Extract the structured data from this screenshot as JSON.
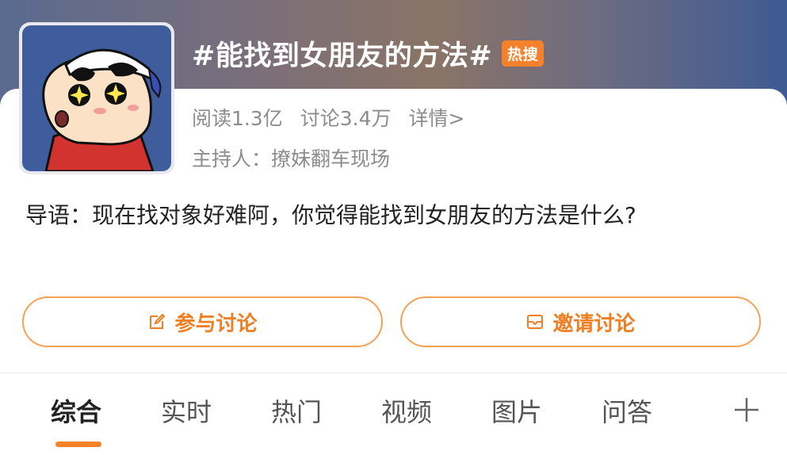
{
  "topic": {
    "title": "#能找到女朋友的方法#",
    "hot_badge": "热搜",
    "reads": "阅读1.3亿",
    "discussions": "讨论3.4万",
    "details_link": "详情>",
    "host": "主持人：撩妹翻车现场",
    "avatar_icon": "cartoon-boy-avatar-icon"
  },
  "intro": {
    "text": "导语：现在找对象好难阿，你觉得能找到女朋友的方法是什么?"
  },
  "actions": {
    "join_label": "参与讨论",
    "join_icon": "edit-icon",
    "invite_label": "邀请讨论",
    "invite_icon": "envelope-icon"
  },
  "tabs": {
    "items": [
      "综合",
      "实时",
      "热门",
      "视频",
      "图片",
      "问答"
    ],
    "active": "综合",
    "more_icon": "plus-icon"
  },
  "colors": {
    "accent": "#f5822a",
    "title_text": "#ffffff",
    "muted_text": "#8c8c8c"
  }
}
